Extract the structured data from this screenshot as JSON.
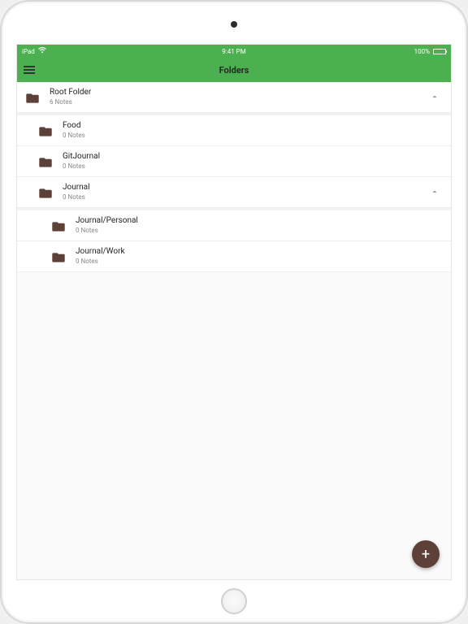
{
  "status": {
    "device": "iPad",
    "time": "9:41 PM",
    "battery_text": "100%"
  },
  "header": {
    "title": "Folders"
  },
  "folders": [
    {
      "name": "Root Folder",
      "subtitle": "6 Notes",
      "level": 0,
      "expandable": true
    },
    {
      "name": "Food",
      "subtitle": "0 Notes",
      "level": 1,
      "expandable": false
    },
    {
      "name": "GitJournal",
      "subtitle": "0 Notes",
      "level": 1,
      "expandable": false
    },
    {
      "name": "Journal",
      "subtitle": "0 Notes",
      "level": 1,
      "expandable": true
    },
    {
      "name": "Journal/Personal",
      "subtitle": "0 Notes",
      "level": 2,
      "expandable": false
    },
    {
      "name": "Journal/Work",
      "subtitle": "0 Notes",
      "level": 2,
      "expandable": false
    }
  ],
  "fab": {
    "label": "+"
  },
  "colors": {
    "primary": "#4caf50",
    "folder": "#5d4037"
  }
}
